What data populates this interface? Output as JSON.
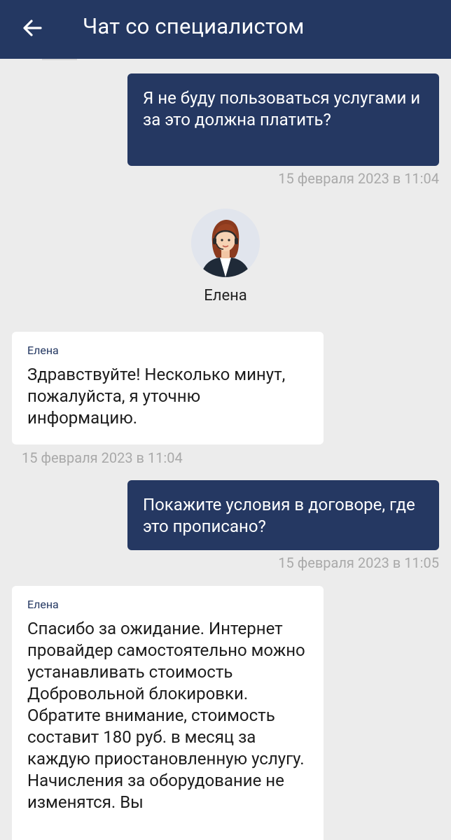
{
  "header": {
    "title": "Чат со специалистом"
  },
  "agent": {
    "name": "Елена"
  },
  "messages": [
    {
      "direction": "out",
      "text": "Я не буду пользоваться услугами и за это должна платить?",
      "time": "15 февраля 2023 в 11:04"
    },
    {
      "direction": "in",
      "sender": "Елена",
      "text": "Здравствуйте! Несколько минут, пожалуйста, я уточню информацию.",
      "time": "15 февраля 2023 в 11:04"
    },
    {
      "direction": "out",
      "text": "Покажите условия в договоре, где это прописано?",
      "time": "15 февраля 2023 в 11:05"
    },
    {
      "direction": "in",
      "sender": "Елена",
      "text": "Спасибо за ожидание. Интернет провайдер самостоятельно можно устанавливать стоимость Добровольной блокировки. Обратите внимание, стоимость составит 180 руб. в месяц за каждую приостановленную услугу. Начисления за оборудование не изменятся. Вы"
    }
  ],
  "colors": {
    "header_bg": "#243862",
    "outgoing_bubble": "#253862",
    "incoming_bubble": "#ffffff",
    "background": "#ececec",
    "timestamp": "#a9a9a9"
  },
  "icons": {
    "back": "arrow-left-icon"
  }
}
